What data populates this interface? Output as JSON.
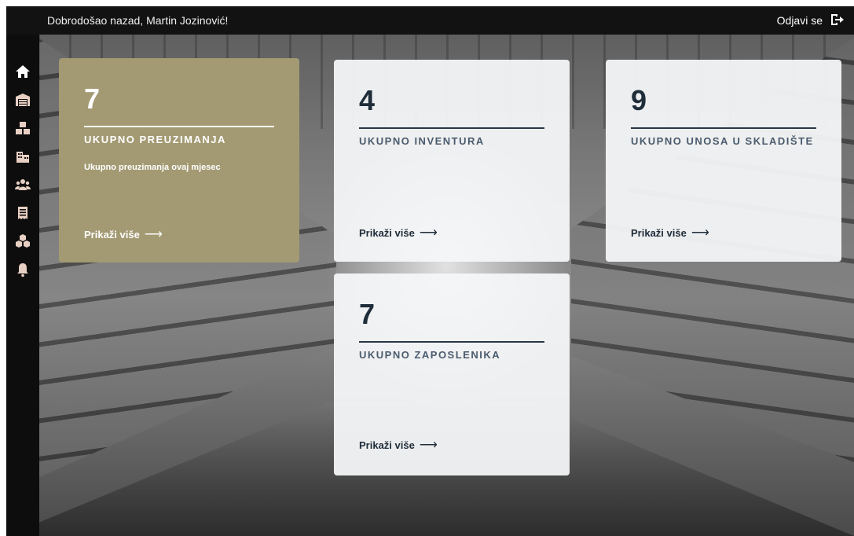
{
  "header": {
    "welcome": "Dobrodošao nazad, Martin Jozinović!",
    "logout_label": "Odjavi se"
  },
  "sidebar": {
    "items": [
      {
        "icon": "home-icon"
      },
      {
        "icon": "warehouse-icon"
      },
      {
        "icon": "boxes-icon"
      },
      {
        "icon": "building-icon"
      },
      {
        "icon": "users-icon"
      },
      {
        "icon": "receipt-icon"
      },
      {
        "icon": "cubes-icon"
      },
      {
        "icon": "bell-icon"
      }
    ],
    "icon_color": "#e8cfc4"
  },
  "cards": [
    {
      "value": "7",
      "title": "UKUPNO PREUZIMANJA",
      "subtitle": "Ukupno preuzimanja ovaj mjesec",
      "link": "Prikaži više",
      "arrow": "⟶"
    },
    {
      "value": "4",
      "title": "UKUPNO INVENTURA",
      "link": "Prikaži više",
      "arrow": "⟶"
    },
    {
      "value": "9",
      "title": "UKUPNO UNOSA U SKLADIŠTE",
      "link": "Prikaži više",
      "arrow": "⟶"
    },
    {
      "value": "7",
      "title": "UKUPNO ZAPOSLENIKA",
      "link": "Prikaži više",
      "arrow": "⟶"
    }
  ],
  "colors": {
    "accent_gold": "#a39a73",
    "card_light": "#f5f6f8",
    "text_dark": "#1f2d3a",
    "topbar": "#121212"
  }
}
